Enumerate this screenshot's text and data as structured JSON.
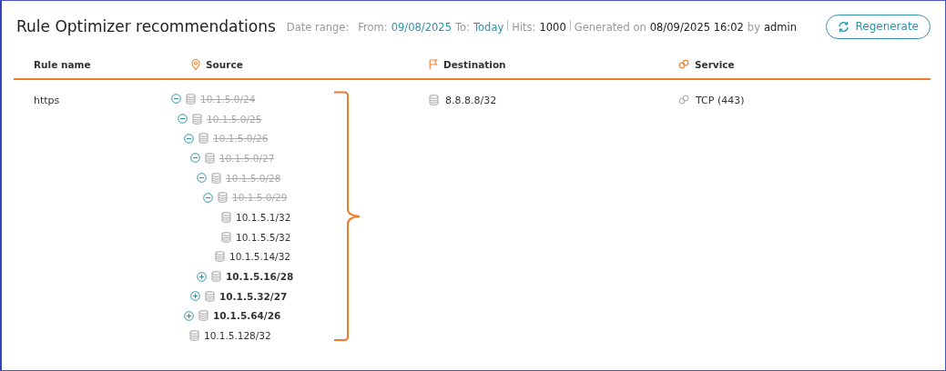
{
  "header": {
    "title": "Rule Optimizer recommendations",
    "date_range_label": "Date range:",
    "from_label": "From:",
    "from_value": "09/08/2025",
    "to_label": "To:",
    "to_value": "Today",
    "hits_label": "Hits:",
    "hits_value": "1000",
    "generated_label": "Generated on",
    "generated_value": "08/09/2025 16:02",
    "by_label": "by",
    "by_value": "admin",
    "button": "Regenerate"
  },
  "table": {
    "columns": [
      {
        "label": "Rule name",
        "kind": "plain"
      },
      {
        "label": "Source",
        "kind": "source"
      },
      {
        "label": "Destination",
        "kind": "destination"
      },
      {
        "label": "Service",
        "kind": "service"
      }
    ],
    "rows": [
      {
        "rule_name": "https",
        "destination": "8.8.8.8/32",
        "service": "TCP (443)",
        "source": [
          {
            "label": "10.1.5.0/24",
            "removed": true,
            "expanded": true,
            "children": [
              {
                "label": "10.1.5.0/25",
                "removed": true,
                "expanded": true,
                "children": [
                  {
                    "label": "10.1.5.0/26",
                    "removed": true,
                    "expanded": true,
                    "children": [
                      {
                        "label": "10.1.5.0/27",
                        "removed": true,
                        "expanded": true,
                        "children": [
                          {
                            "label": "10.1.5.0/28",
                            "removed": true,
                            "expanded": true,
                            "children": [
                              {
                                "label": "10.1.5.0/29",
                                "removed": true,
                                "expanded": true,
                                "children": [
                                  {
                                    "label": "10.1.5.1/32",
                                    "removed": false
                                  },
                                  {
                                    "label": "10.1.5.5/32",
                                    "removed": false
                                  }
                                ]
                              },
                              {
                                "label": "10.1.5.14/32",
                                "removed": false
                              }
                            ]
                          },
                          {
                            "label": "10.1.5.16/28",
                            "removed": false,
                            "expanded": false
                          }
                        ]
                      },
                      {
                        "label": "10.1.5.32/27",
                        "removed": false,
                        "expanded": false
                      }
                    ]
                  },
                  {
                    "label": "10.1.5.64/26",
                    "removed": false,
                    "expanded": false
                  }
                ]
              },
              {
                "label": "10.1.5.128/32",
                "removed": false
              }
            ]
          }
        ]
      }
    ]
  }
}
